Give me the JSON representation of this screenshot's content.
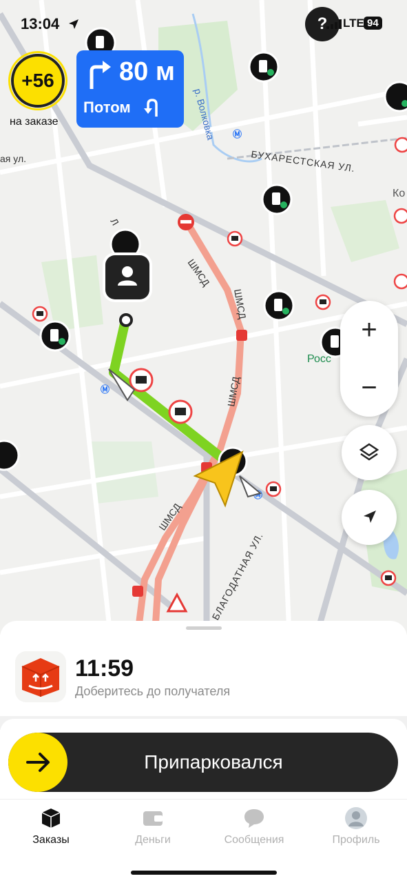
{
  "status_bar": {
    "time": "13:04",
    "network": "LTE",
    "battery": "94",
    "help": "?"
  },
  "bonus": {
    "value": "+56",
    "label": "на заказе"
  },
  "maneuver": {
    "distance": "80 м",
    "next_label": "Потом",
    "turn": "right",
    "next_turn": "u-turn"
  },
  "map": {
    "labels": [
      "р. Волковка",
      "БУХАРЕСТСКАЯ УЛ.",
      "ШМСД",
      "ШМСД",
      "ШМСД",
      "ШМСД",
      "БЛАГОДАТНАЯ УЛ.",
      "Росс",
      "Ко",
      "Л",
      "ая ул."
    ],
    "controls": {
      "zoom_in": "+",
      "zoom_out": "−"
    },
    "colors": {
      "route": "#7ed321",
      "toll_road": "#f3a08f",
      "background": "#f1f1ef"
    }
  },
  "order": {
    "eta": "11:59",
    "subtitle": "Доберитесь до получателя"
  },
  "action": {
    "label": "Припарковался"
  },
  "tabs": [
    {
      "label": "Заказы",
      "icon": "cube-icon",
      "active": true
    },
    {
      "label": "Деньги",
      "icon": "wallet-icon",
      "active": false
    },
    {
      "label": "Сообщения",
      "icon": "chat-icon",
      "active": false
    },
    {
      "label": "Профиль",
      "icon": "profile-avatar",
      "active": false
    }
  ]
}
